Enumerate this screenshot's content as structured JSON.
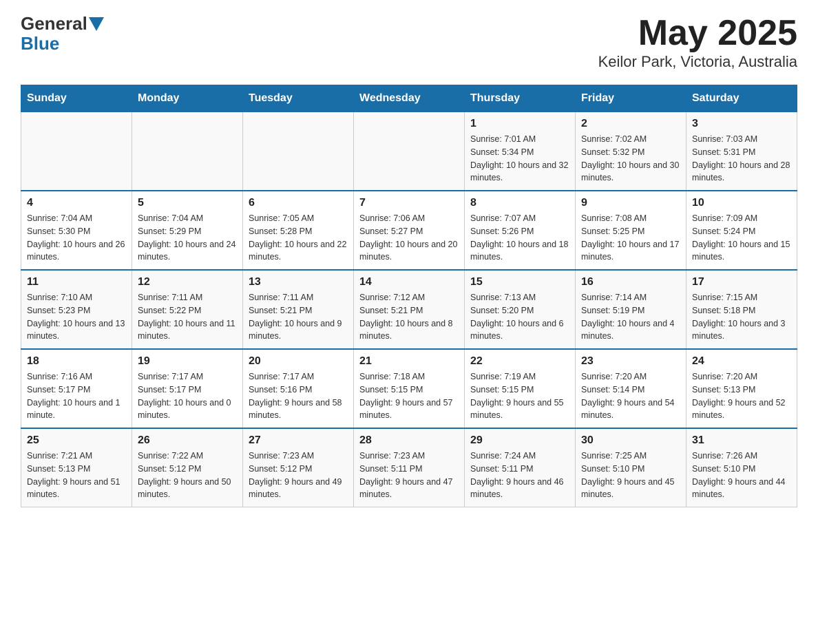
{
  "header": {
    "logo_general": "General",
    "logo_blue": "Blue",
    "title": "May 2025",
    "subtitle": "Keilor Park, Victoria, Australia"
  },
  "days_of_week": [
    "Sunday",
    "Monday",
    "Tuesday",
    "Wednesday",
    "Thursday",
    "Friday",
    "Saturday"
  ],
  "weeks": [
    {
      "days": [
        {
          "number": "",
          "info": ""
        },
        {
          "number": "",
          "info": ""
        },
        {
          "number": "",
          "info": ""
        },
        {
          "number": "",
          "info": ""
        },
        {
          "number": "1",
          "info": "Sunrise: 7:01 AM\nSunset: 5:34 PM\nDaylight: 10 hours and 32 minutes."
        },
        {
          "number": "2",
          "info": "Sunrise: 7:02 AM\nSunset: 5:32 PM\nDaylight: 10 hours and 30 minutes."
        },
        {
          "number": "3",
          "info": "Sunrise: 7:03 AM\nSunset: 5:31 PM\nDaylight: 10 hours and 28 minutes."
        }
      ]
    },
    {
      "days": [
        {
          "number": "4",
          "info": "Sunrise: 7:04 AM\nSunset: 5:30 PM\nDaylight: 10 hours and 26 minutes."
        },
        {
          "number": "5",
          "info": "Sunrise: 7:04 AM\nSunset: 5:29 PM\nDaylight: 10 hours and 24 minutes."
        },
        {
          "number": "6",
          "info": "Sunrise: 7:05 AM\nSunset: 5:28 PM\nDaylight: 10 hours and 22 minutes."
        },
        {
          "number": "7",
          "info": "Sunrise: 7:06 AM\nSunset: 5:27 PM\nDaylight: 10 hours and 20 minutes."
        },
        {
          "number": "8",
          "info": "Sunrise: 7:07 AM\nSunset: 5:26 PM\nDaylight: 10 hours and 18 minutes."
        },
        {
          "number": "9",
          "info": "Sunrise: 7:08 AM\nSunset: 5:25 PM\nDaylight: 10 hours and 17 minutes."
        },
        {
          "number": "10",
          "info": "Sunrise: 7:09 AM\nSunset: 5:24 PM\nDaylight: 10 hours and 15 minutes."
        }
      ]
    },
    {
      "days": [
        {
          "number": "11",
          "info": "Sunrise: 7:10 AM\nSunset: 5:23 PM\nDaylight: 10 hours and 13 minutes."
        },
        {
          "number": "12",
          "info": "Sunrise: 7:11 AM\nSunset: 5:22 PM\nDaylight: 10 hours and 11 minutes."
        },
        {
          "number": "13",
          "info": "Sunrise: 7:11 AM\nSunset: 5:21 PM\nDaylight: 10 hours and 9 minutes."
        },
        {
          "number": "14",
          "info": "Sunrise: 7:12 AM\nSunset: 5:21 PM\nDaylight: 10 hours and 8 minutes."
        },
        {
          "number": "15",
          "info": "Sunrise: 7:13 AM\nSunset: 5:20 PM\nDaylight: 10 hours and 6 minutes."
        },
        {
          "number": "16",
          "info": "Sunrise: 7:14 AM\nSunset: 5:19 PM\nDaylight: 10 hours and 4 minutes."
        },
        {
          "number": "17",
          "info": "Sunrise: 7:15 AM\nSunset: 5:18 PM\nDaylight: 10 hours and 3 minutes."
        }
      ]
    },
    {
      "days": [
        {
          "number": "18",
          "info": "Sunrise: 7:16 AM\nSunset: 5:17 PM\nDaylight: 10 hours and 1 minute."
        },
        {
          "number": "19",
          "info": "Sunrise: 7:17 AM\nSunset: 5:17 PM\nDaylight: 10 hours and 0 minutes."
        },
        {
          "number": "20",
          "info": "Sunrise: 7:17 AM\nSunset: 5:16 PM\nDaylight: 9 hours and 58 minutes."
        },
        {
          "number": "21",
          "info": "Sunrise: 7:18 AM\nSunset: 5:15 PM\nDaylight: 9 hours and 57 minutes."
        },
        {
          "number": "22",
          "info": "Sunrise: 7:19 AM\nSunset: 5:15 PM\nDaylight: 9 hours and 55 minutes."
        },
        {
          "number": "23",
          "info": "Sunrise: 7:20 AM\nSunset: 5:14 PM\nDaylight: 9 hours and 54 minutes."
        },
        {
          "number": "24",
          "info": "Sunrise: 7:20 AM\nSunset: 5:13 PM\nDaylight: 9 hours and 52 minutes."
        }
      ]
    },
    {
      "days": [
        {
          "number": "25",
          "info": "Sunrise: 7:21 AM\nSunset: 5:13 PM\nDaylight: 9 hours and 51 minutes."
        },
        {
          "number": "26",
          "info": "Sunrise: 7:22 AM\nSunset: 5:12 PM\nDaylight: 9 hours and 50 minutes."
        },
        {
          "number": "27",
          "info": "Sunrise: 7:23 AM\nSunset: 5:12 PM\nDaylight: 9 hours and 49 minutes."
        },
        {
          "number": "28",
          "info": "Sunrise: 7:23 AM\nSunset: 5:11 PM\nDaylight: 9 hours and 47 minutes."
        },
        {
          "number": "29",
          "info": "Sunrise: 7:24 AM\nSunset: 5:11 PM\nDaylight: 9 hours and 46 minutes."
        },
        {
          "number": "30",
          "info": "Sunrise: 7:25 AM\nSunset: 5:10 PM\nDaylight: 9 hours and 45 minutes."
        },
        {
          "number": "31",
          "info": "Sunrise: 7:26 AM\nSunset: 5:10 PM\nDaylight: 9 hours and 44 minutes."
        }
      ]
    }
  ]
}
